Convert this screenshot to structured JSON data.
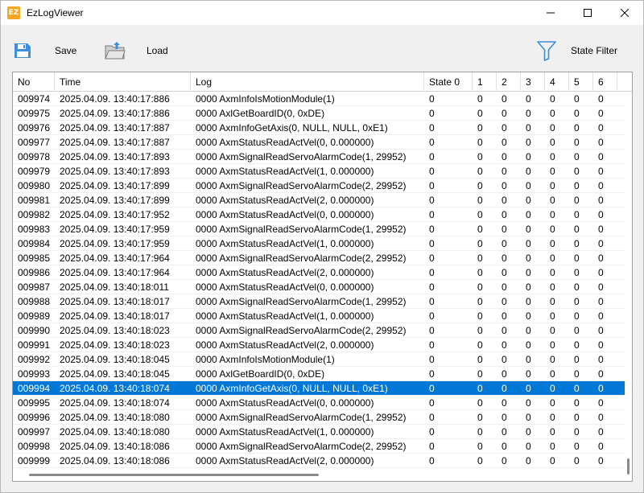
{
  "window": {
    "title": "EzLogViewer",
    "app_icon_text": "EZ"
  },
  "toolbar": {
    "save_label": "Save",
    "load_label": "Load",
    "filter_label": "State Filter"
  },
  "grid": {
    "columns": [
      "No",
      "Time",
      "Log",
      "State 0",
      "1",
      "2",
      "3",
      "4",
      "5",
      "6"
    ],
    "selected_row_no": "009994",
    "rows": [
      [
        "009974",
        "2025.04.09. 13:40:17:886",
        "0000 AxmInfoIsMotionModule(1)",
        "0",
        "0",
        "0",
        "0",
        "0",
        "0",
        "0"
      ],
      [
        "009975",
        "2025.04.09. 13:40:17:886",
        "0000 AxlGetBoardID(0, 0xDE)",
        "0",
        "0",
        "0",
        "0",
        "0",
        "0",
        "0"
      ],
      [
        "009976",
        "2025.04.09. 13:40:17:887",
        "0000 AxmInfoGetAxis(0, NULL, NULL, 0xE1)",
        "0",
        "0",
        "0",
        "0",
        "0",
        "0",
        "0"
      ],
      [
        "009977",
        "2025.04.09. 13:40:17:887",
        "0000 AxmStatusReadActVel(0, 0.000000)",
        "0",
        "0",
        "0",
        "0",
        "0",
        "0",
        "0"
      ],
      [
        "009978",
        "2025.04.09. 13:40:17:893",
        "0000 AxmSignalReadServoAlarmCode(1, 29952)",
        "0",
        "0",
        "0",
        "0",
        "0",
        "0",
        "0"
      ],
      [
        "009979",
        "2025.04.09. 13:40:17:893",
        "0000 AxmStatusReadActVel(1, 0.000000)",
        "0",
        "0",
        "0",
        "0",
        "0",
        "0",
        "0"
      ],
      [
        "009980",
        "2025.04.09. 13:40:17:899",
        "0000 AxmSignalReadServoAlarmCode(2, 29952)",
        "0",
        "0",
        "0",
        "0",
        "0",
        "0",
        "0"
      ],
      [
        "009981",
        "2025.04.09. 13:40:17:899",
        "0000 AxmStatusReadActVel(2, 0.000000)",
        "0",
        "0",
        "0",
        "0",
        "0",
        "0",
        "0"
      ],
      [
        "009982",
        "2025.04.09. 13:40:17:952",
        "0000 AxmStatusReadActVel(0, 0.000000)",
        "0",
        "0",
        "0",
        "0",
        "0",
        "0",
        "0"
      ],
      [
        "009983",
        "2025.04.09. 13:40:17:959",
        "0000 AxmSignalReadServoAlarmCode(1, 29952)",
        "0",
        "0",
        "0",
        "0",
        "0",
        "0",
        "0"
      ],
      [
        "009984",
        "2025.04.09. 13:40:17:959",
        "0000 AxmStatusReadActVel(1, 0.000000)",
        "0",
        "0",
        "0",
        "0",
        "0",
        "0",
        "0"
      ],
      [
        "009985",
        "2025.04.09. 13:40:17:964",
        "0000 AxmSignalReadServoAlarmCode(2, 29952)",
        "0",
        "0",
        "0",
        "0",
        "0",
        "0",
        "0"
      ],
      [
        "009986",
        "2025.04.09. 13:40:17:964",
        "0000 AxmStatusReadActVel(2, 0.000000)",
        "0",
        "0",
        "0",
        "0",
        "0",
        "0",
        "0"
      ],
      [
        "009987",
        "2025.04.09. 13:40:18:011",
        "0000 AxmStatusReadActVel(0, 0.000000)",
        "0",
        "0",
        "0",
        "0",
        "0",
        "0",
        "0"
      ],
      [
        "009988",
        "2025.04.09. 13:40:18:017",
        "0000 AxmSignalReadServoAlarmCode(1, 29952)",
        "0",
        "0",
        "0",
        "0",
        "0",
        "0",
        "0"
      ],
      [
        "009989",
        "2025.04.09. 13:40:18:017",
        "0000 AxmStatusReadActVel(1, 0.000000)",
        "0",
        "0",
        "0",
        "0",
        "0",
        "0",
        "0"
      ],
      [
        "009990",
        "2025.04.09. 13:40:18:023",
        "0000 AxmSignalReadServoAlarmCode(2, 29952)",
        "0",
        "0",
        "0",
        "0",
        "0",
        "0",
        "0"
      ],
      [
        "009991",
        "2025.04.09. 13:40:18:023",
        "0000 AxmStatusReadActVel(2, 0.000000)",
        "0",
        "0",
        "0",
        "0",
        "0",
        "0",
        "0"
      ],
      [
        "009992",
        "2025.04.09. 13:40:18:045",
        "0000 AxmInfoIsMotionModule(1)",
        "0",
        "0",
        "0",
        "0",
        "0",
        "0",
        "0"
      ],
      [
        "009993",
        "2025.04.09. 13:40:18:045",
        "0000 AxlGetBoardID(0, 0xDE)",
        "0",
        "0",
        "0",
        "0",
        "0",
        "0",
        "0"
      ],
      [
        "009994",
        "2025.04.09. 13:40:18:074",
        "0000 AxmInfoGetAxis(0, NULL, NULL, 0xE1)",
        "0",
        "0",
        "0",
        "0",
        "0",
        "0",
        "0"
      ],
      [
        "009995",
        "2025.04.09. 13:40:18:074",
        "0000 AxmStatusReadActVel(0, 0.000000)",
        "0",
        "0",
        "0",
        "0",
        "0",
        "0",
        "0"
      ],
      [
        "009996",
        "2025.04.09. 13:40:18:080",
        "0000 AxmSignalReadServoAlarmCode(1, 29952)",
        "0",
        "0",
        "0",
        "0",
        "0",
        "0",
        "0"
      ],
      [
        "009997",
        "2025.04.09. 13:40:18:080",
        "0000 AxmStatusReadActVel(1, 0.000000)",
        "0",
        "0",
        "0",
        "0",
        "0",
        "0",
        "0"
      ],
      [
        "009998",
        "2025.04.09. 13:40:18:086",
        "0000 AxmSignalReadServoAlarmCode(2, 29952)",
        "0",
        "0",
        "0",
        "0",
        "0",
        "0",
        "0"
      ],
      [
        "009999",
        "2025.04.09. 13:40:18:086",
        "0000 AxmStatusReadActVel(2, 0.000000)",
        "0",
        "0",
        "0",
        "0",
        "0",
        "0",
        "0"
      ]
    ]
  },
  "icons": {
    "save": "floppy-disk-icon",
    "load": "open-folder-icon",
    "filter": "funnel-icon"
  },
  "colors": {
    "selection": "#0078d7",
    "icon_blue": "#3c8fd8"
  }
}
